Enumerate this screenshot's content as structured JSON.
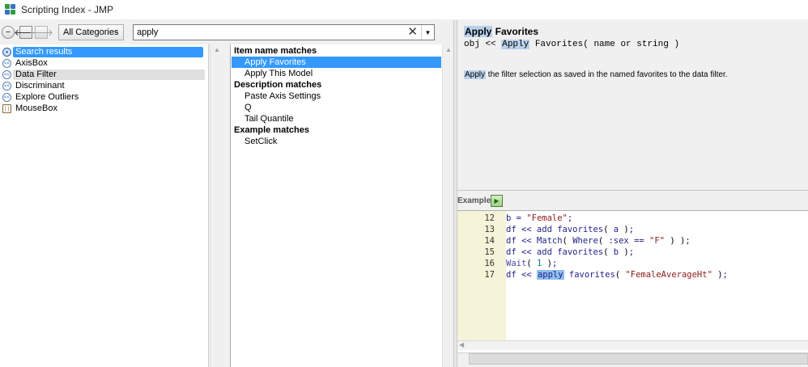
{
  "window": {
    "title": "Scripting Index - JMP"
  },
  "toolbar": {
    "category_value": "All Categories",
    "search_value": "apply"
  },
  "left_tree": {
    "items": [
      {
        "label": "Search results",
        "icon": "search-results-icon",
        "state": "selected"
      },
      {
        "label": "AxisBox",
        "icon": "object-icon",
        "state": "normal"
      },
      {
        "label": "Data Filter",
        "icon": "object-icon",
        "state": "highlighted"
      },
      {
        "label": "Discriminant",
        "icon": "object-icon",
        "state": "normal"
      },
      {
        "label": "Explore Outliers",
        "icon": "object-icon",
        "state": "normal"
      },
      {
        "label": "MouseBox",
        "icon": "box-icon",
        "state": "normal"
      }
    ]
  },
  "results": {
    "item_header": "Item name matches",
    "item_matches": [
      "Apply Favorites",
      "Apply This Model"
    ],
    "desc_header": "Description matches",
    "desc_matches": [
      "Paste Axis Settings",
      "Q",
      "Tail Quantile"
    ],
    "example_header": "Example matches",
    "example_matches": [
      "SetClick"
    ]
  },
  "doc": {
    "title_hl": "Apply",
    "title_rest": " Favorites",
    "syntax_pre": "obj << ",
    "syntax_hl": "Apply",
    "syntax_post": " Favorites( name or string )",
    "desc_hl": "Apply",
    "desc_rest": " the filter selection as saved in the named favorites to the data filter."
  },
  "example": {
    "label": "Example",
    "line_numbers": [
      "12",
      "13",
      "14",
      "15",
      "16",
      "17"
    ]
  },
  "colors": {
    "selection": "#3399ff",
    "search_highlight": "#b9d1ea",
    "gutter": "#f5f4d9",
    "code_text": "#1f1f8a",
    "string": "#8b1a1a"
  }
}
